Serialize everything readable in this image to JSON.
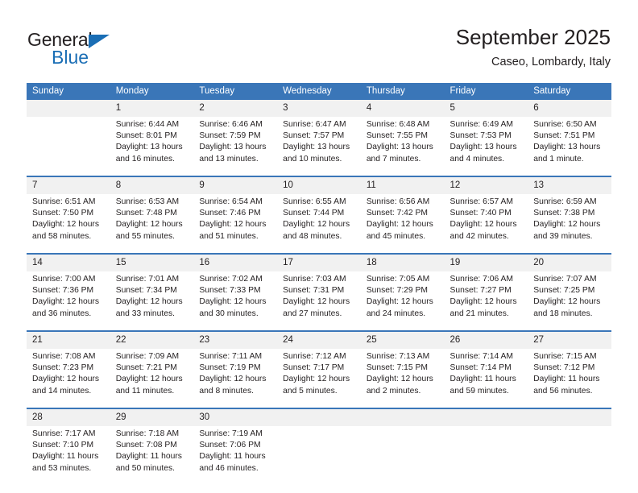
{
  "brand": {
    "name_part1": "General",
    "name_part2": "Blue",
    "accent_color": "#1a6eb5"
  },
  "header": {
    "title": "September 2025",
    "subtitle": "Caseo, Lombardy, Italy"
  },
  "theme": {
    "header_blue": "#3a76b8",
    "daynum_gray": "#f1f1f1",
    "text": "#231f20"
  },
  "calendar": {
    "weekday_headers": [
      "Sunday",
      "Monday",
      "Tuesday",
      "Wednesday",
      "Thursday",
      "Friday",
      "Saturday"
    ],
    "weeks": [
      [
        {
          "day": "",
          "sunrise": "",
          "sunset": "",
          "daylight_line1": "",
          "daylight_line2": ""
        },
        {
          "day": "1",
          "sunrise": "Sunrise: 6:44 AM",
          "sunset": "Sunset: 8:01 PM",
          "daylight_line1": "Daylight: 13 hours",
          "daylight_line2": "and 16 minutes."
        },
        {
          "day": "2",
          "sunrise": "Sunrise: 6:46 AM",
          "sunset": "Sunset: 7:59 PM",
          "daylight_line1": "Daylight: 13 hours",
          "daylight_line2": "and 13 minutes."
        },
        {
          "day": "3",
          "sunrise": "Sunrise: 6:47 AM",
          "sunset": "Sunset: 7:57 PM",
          "daylight_line1": "Daylight: 13 hours",
          "daylight_line2": "and 10 minutes."
        },
        {
          "day": "4",
          "sunrise": "Sunrise: 6:48 AM",
          "sunset": "Sunset: 7:55 PM",
          "daylight_line1": "Daylight: 13 hours",
          "daylight_line2": "and 7 minutes."
        },
        {
          "day": "5",
          "sunrise": "Sunrise: 6:49 AM",
          "sunset": "Sunset: 7:53 PM",
          "daylight_line1": "Daylight: 13 hours",
          "daylight_line2": "and 4 minutes."
        },
        {
          "day": "6",
          "sunrise": "Sunrise: 6:50 AM",
          "sunset": "Sunset: 7:51 PM",
          "daylight_line1": "Daylight: 13 hours",
          "daylight_line2": "and 1 minute."
        }
      ],
      [
        {
          "day": "7",
          "sunrise": "Sunrise: 6:51 AM",
          "sunset": "Sunset: 7:50 PM",
          "daylight_line1": "Daylight: 12 hours",
          "daylight_line2": "and 58 minutes."
        },
        {
          "day": "8",
          "sunrise": "Sunrise: 6:53 AM",
          "sunset": "Sunset: 7:48 PM",
          "daylight_line1": "Daylight: 12 hours",
          "daylight_line2": "and 55 minutes."
        },
        {
          "day": "9",
          "sunrise": "Sunrise: 6:54 AM",
          "sunset": "Sunset: 7:46 PM",
          "daylight_line1": "Daylight: 12 hours",
          "daylight_line2": "and 51 minutes."
        },
        {
          "day": "10",
          "sunrise": "Sunrise: 6:55 AM",
          "sunset": "Sunset: 7:44 PM",
          "daylight_line1": "Daylight: 12 hours",
          "daylight_line2": "and 48 minutes."
        },
        {
          "day": "11",
          "sunrise": "Sunrise: 6:56 AM",
          "sunset": "Sunset: 7:42 PM",
          "daylight_line1": "Daylight: 12 hours",
          "daylight_line2": "and 45 minutes."
        },
        {
          "day": "12",
          "sunrise": "Sunrise: 6:57 AM",
          "sunset": "Sunset: 7:40 PM",
          "daylight_line1": "Daylight: 12 hours",
          "daylight_line2": "and 42 minutes."
        },
        {
          "day": "13",
          "sunrise": "Sunrise: 6:59 AM",
          "sunset": "Sunset: 7:38 PM",
          "daylight_line1": "Daylight: 12 hours",
          "daylight_line2": "and 39 minutes."
        }
      ],
      [
        {
          "day": "14",
          "sunrise": "Sunrise: 7:00 AM",
          "sunset": "Sunset: 7:36 PM",
          "daylight_line1": "Daylight: 12 hours",
          "daylight_line2": "and 36 minutes."
        },
        {
          "day": "15",
          "sunrise": "Sunrise: 7:01 AM",
          "sunset": "Sunset: 7:34 PM",
          "daylight_line1": "Daylight: 12 hours",
          "daylight_line2": "and 33 minutes."
        },
        {
          "day": "16",
          "sunrise": "Sunrise: 7:02 AM",
          "sunset": "Sunset: 7:33 PM",
          "daylight_line1": "Daylight: 12 hours",
          "daylight_line2": "and 30 minutes."
        },
        {
          "day": "17",
          "sunrise": "Sunrise: 7:03 AM",
          "sunset": "Sunset: 7:31 PM",
          "daylight_line1": "Daylight: 12 hours",
          "daylight_line2": "and 27 minutes."
        },
        {
          "day": "18",
          "sunrise": "Sunrise: 7:05 AM",
          "sunset": "Sunset: 7:29 PM",
          "daylight_line1": "Daylight: 12 hours",
          "daylight_line2": "and 24 minutes."
        },
        {
          "day": "19",
          "sunrise": "Sunrise: 7:06 AM",
          "sunset": "Sunset: 7:27 PM",
          "daylight_line1": "Daylight: 12 hours",
          "daylight_line2": "and 21 minutes."
        },
        {
          "day": "20",
          "sunrise": "Sunrise: 7:07 AM",
          "sunset": "Sunset: 7:25 PM",
          "daylight_line1": "Daylight: 12 hours",
          "daylight_line2": "and 18 minutes."
        }
      ],
      [
        {
          "day": "21",
          "sunrise": "Sunrise: 7:08 AM",
          "sunset": "Sunset: 7:23 PM",
          "daylight_line1": "Daylight: 12 hours",
          "daylight_line2": "and 14 minutes."
        },
        {
          "day": "22",
          "sunrise": "Sunrise: 7:09 AM",
          "sunset": "Sunset: 7:21 PM",
          "daylight_line1": "Daylight: 12 hours",
          "daylight_line2": "and 11 minutes."
        },
        {
          "day": "23",
          "sunrise": "Sunrise: 7:11 AM",
          "sunset": "Sunset: 7:19 PM",
          "daylight_line1": "Daylight: 12 hours",
          "daylight_line2": "and 8 minutes."
        },
        {
          "day": "24",
          "sunrise": "Sunrise: 7:12 AM",
          "sunset": "Sunset: 7:17 PM",
          "daylight_line1": "Daylight: 12 hours",
          "daylight_line2": "and 5 minutes."
        },
        {
          "day": "25",
          "sunrise": "Sunrise: 7:13 AM",
          "sunset": "Sunset: 7:15 PM",
          "daylight_line1": "Daylight: 12 hours",
          "daylight_line2": "and 2 minutes."
        },
        {
          "day": "26",
          "sunrise": "Sunrise: 7:14 AM",
          "sunset": "Sunset: 7:14 PM",
          "daylight_line1": "Daylight: 11 hours",
          "daylight_line2": "and 59 minutes."
        },
        {
          "day": "27",
          "sunrise": "Sunrise: 7:15 AM",
          "sunset": "Sunset: 7:12 PM",
          "daylight_line1": "Daylight: 11 hours",
          "daylight_line2": "and 56 minutes."
        }
      ],
      [
        {
          "day": "28",
          "sunrise": "Sunrise: 7:17 AM",
          "sunset": "Sunset: 7:10 PM",
          "daylight_line1": "Daylight: 11 hours",
          "daylight_line2": "and 53 minutes."
        },
        {
          "day": "29",
          "sunrise": "Sunrise: 7:18 AM",
          "sunset": "Sunset: 7:08 PM",
          "daylight_line1": "Daylight: 11 hours",
          "daylight_line2": "and 50 minutes."
        },
        {
          "day": "30",
          "sunrise": "Sunrise: 7:19 AM",
          "sunset": "Sunset: 7:06 PM",
          "daylight_line1": "Daylight: 11 hours",
          "daylight_line2": "and 46 minutes."
        },
        {
          "day": "",
          "sunrise": "",
          "sunset": "",
          "daylight_line1": "",
          "daylight_line2": ""
        },
        {
          "day": "",
          "sunrise": "",
          "sunset": "",
          "daylight_line1": "",
          "daylight_line2": ""
        },
        {
          "day": "",
          "sunrise": "",
          "sunset": "",
          "daylight_line1": "",
          "daylight_line2": ""
        },
        {
          "day": "",
          "sunrise": "",
          "sunset": "",
          "daylight_line1": "",
          "daylight_line2": ""
        }
      ]
    ]
  }
}
